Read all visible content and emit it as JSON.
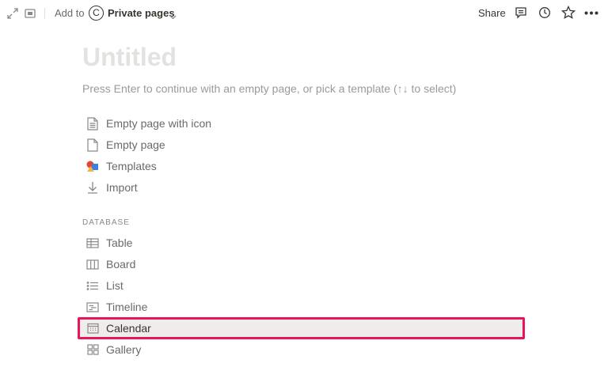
{
  "topbar": {
    "add_to_label": "Add to",
    "avatar_letter": "C",
    "workspace_label": "Private pages",
    "share_label": "Share"
  },
  "page": {
    "title_placeholder": "Untitled",
    "hint": "Press Enter to continue with an empty page, or pick a template (↑↓ to select)"
  },
  "options": [
    {
      "label": "Empty page with icon",
      "icon": "page-lines-icon"
    },
    {
      "label": "Empty page",
      "icon": "page-icon"
    },
    {
      "label": "Templates",
      "icon": "templates-shapes-icon"
    },
    {
      "label": "Import",
      "icon": "download-arrow-icon"
    }
  ],
  "database": {
    "section_label": "DATABASE",
    "items": [
      {
        "label": "Table",
        "icon": "table-icon"
      },
      {
        "label": "Board",
        "icon": "board-icon"
      },
      {
        "label": "List",
        "icon": "list-icon"
      },
      {
        "label": "Timeline",
        "icon": "timeline-icon"
      },
      {
        "label": "Calendar",
        "icon": "calendar-icon",
        "selected": true
      },
      {
        "label": "Gallery",
        "icon": "gallery-icon"
      }
    ]
  },
  "colors": {
    "highlight_border": "#e8155a",
    "highlight_fill": "#efedec"
  }
}
